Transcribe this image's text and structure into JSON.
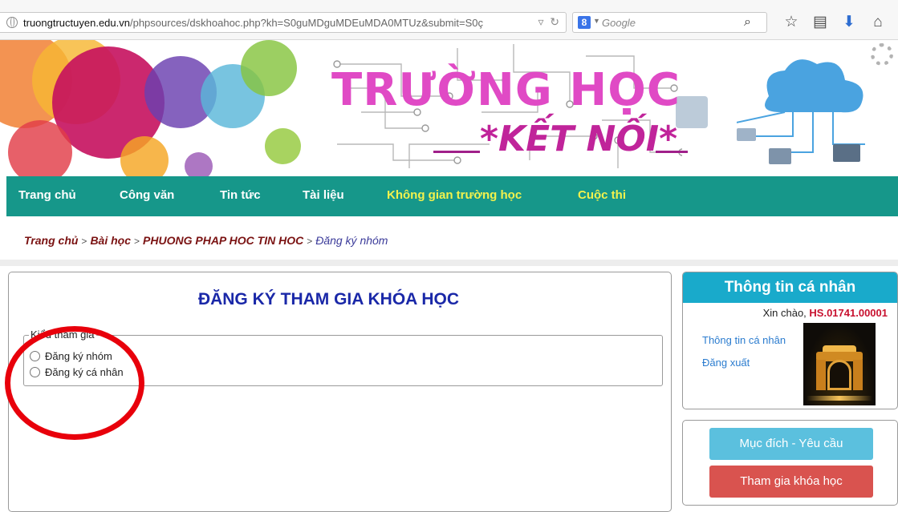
{
  "browser": {
    "url_domain": "truongtructuyen.edu.vn",
    "url_path": "/phpsources/dskhoahoc.php?kh=S0guMDguMDEuMDA0MTUz&submit=S0ç",
    "search_engine_icon": "8",
    "search_placeholder": "Google"
  },
  "banner": {
    "title": "TRƯỜNG HỌC",
    "subtitle": "*KẾT NỐI*"
  },
  "nav": {
    "items": [
      {
        "label": "Trang chủ"
      },
      {
        "label": "Công văn"
      },
      {
        "label": "Tin tức"
      },
      {
        "label": "Tài liệu"
      },
      {
        "label": "Không gian trường học"
      },
      {
        "label": "Cuộc thi"
      }
    ]
  },
  "breadcrumb": {
    "items": [
      "Trang chủ",
      "Bài học",
      "PHUONG PHAP HOC TIN HOC"
    ],
    "current": "Đăng ký nhóm",
    "separator": ">"
  },
  "main": {
    "title": "ĐĂNG KÝ THAM GIA KHÓA HỌC",
    "fieldset_legend": "Kiểu tham gia",
    "options": [
      {
        "label": "Đăng ký nhóm",
        "checked": false
      },
      {
        "label": "Đăng ký cá nhân",
        "checked": false
      }
    ]
  },
  "sidebar": {
    "header": "Thông tin cá nhân",
    "greeting": "Xin chào,",
    "username": "HS.01741.00001",
    "links": [
      "Thông tin cá nhân",
      "Đăng xuất"
    ],
    "buttons": {
      "purpose": "Mục đích - Yêu cầu",
      "join": "Tham gia khóa học"
    }
  },
  "colors": {
    "nav_bg": "#16978a",
    "nav_highlight": "#f2f24d",
    "title_blue": "#1a28a8",
    "sidebar_header": "#19aacb",
    "btn_info": "#5bc0de",
    "btn_danger": "#d9534f",
    "annotation_red": "#e8000b"
  }
}
